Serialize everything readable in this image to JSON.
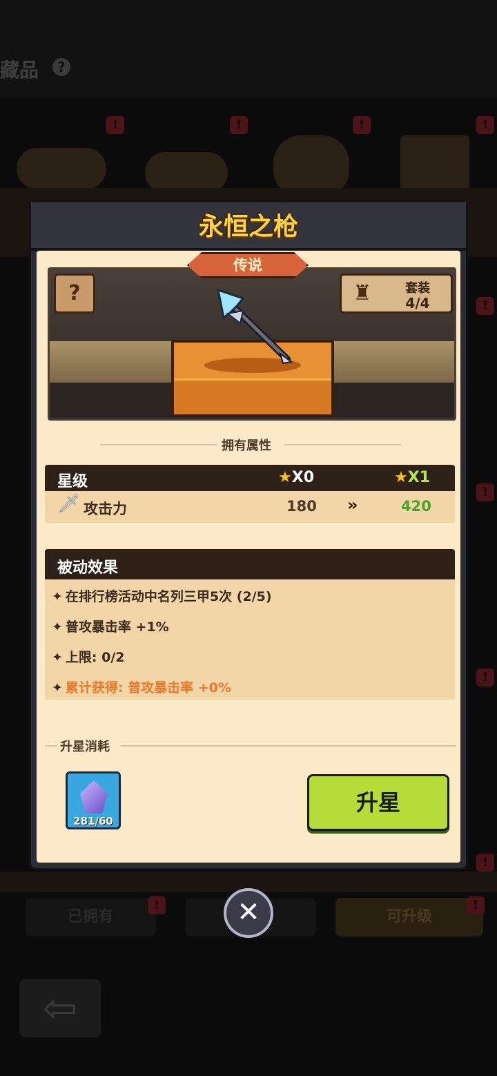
{
  "background": {
    "title": "藏品",
    "tabs": [
      "已拥有",
      "",
      "可升级"
    ]
  },
  "modal": {
    "title": "永恒之枪",
    "rarity": "传说",
    "set": {
      "label": "套装",
      "count": "4/4"
    },
    "owned_attributes_label": "拥有属性",
    "stats": {
      "header_label": "星级",
      "current_star": "X0",
      "next_star": "X1",
      "rows": [
        {
          "name": "攻击力",
          "current": "180",
          "next": "420"
        }
      ]
    },
    "passive": {
      "title": "被动效果",
      "lines": [
        "在排行榜活动中名列三甲5次 (2/5)",
        "普攻暴击率 +1%",
        "上限: 0/2",
        "累计获得: 普攻暴击率 +0%"
      ]
    },
    "cost": {
      "label": "升星消耗",
      "material_count": "281/60"
    },
    "upgrade_button": "升星"
  },
  "colors": {
    "title_gold": "#ffd24a",
    "panel": "#fbe9c8",
    "upgrade_green": "#b6dc3a",
    "next_value_green": "#4aa32a",
    "accumulated_orange": "#e8782a"
  },
  "icons": [
    "help-icon",
    "book-icon",
    "trophy-icon",
    "spear-icon",
    "sword-icon",
    "star-icon",
    "gem-icon",
    "close-icon",
    "back-arrow-icon"
  ]
}
